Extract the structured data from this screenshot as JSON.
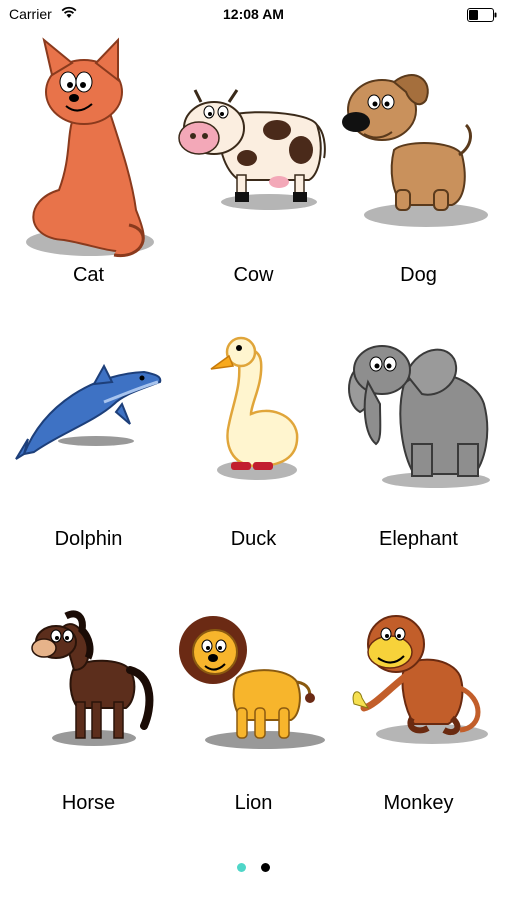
{
  "status_bar": {
    "carrier": "Carrier",
    "time": "12:08 AM",
    "battery_level": 0.4
  },
  "animals": [
    {
      "label": "Cat",
      "icon": "cat-icon"
    },
    {
      "label": "Cow",
      "icon": "cow-icon"
    },
    {
      "label": "Dog",
      "icon": "dog-icon"
    },
    {
      "label": "Dolphin",
      "icon": "dolphin-icon"
    },
    {
      "label": "Duck",
      "icon": "duck-icon"
    },
    {
      "label": "Elephant",
      "icon": "elephant-icon"
    },
    {
      "label": "Horse",
      "icon": "horse-icon"
    },
    {
      "label": "Lion",
      "icon": "lion-icon"
    },
    {
      "label": "Monkey",
      "icon": "monkey-icon"
    }
  ],
  "pagination": {
    "pages": 2,
    "current": 1,
    "active_color": "#4fd6c8",
    "inactive_color": "#000000"
  }
}
